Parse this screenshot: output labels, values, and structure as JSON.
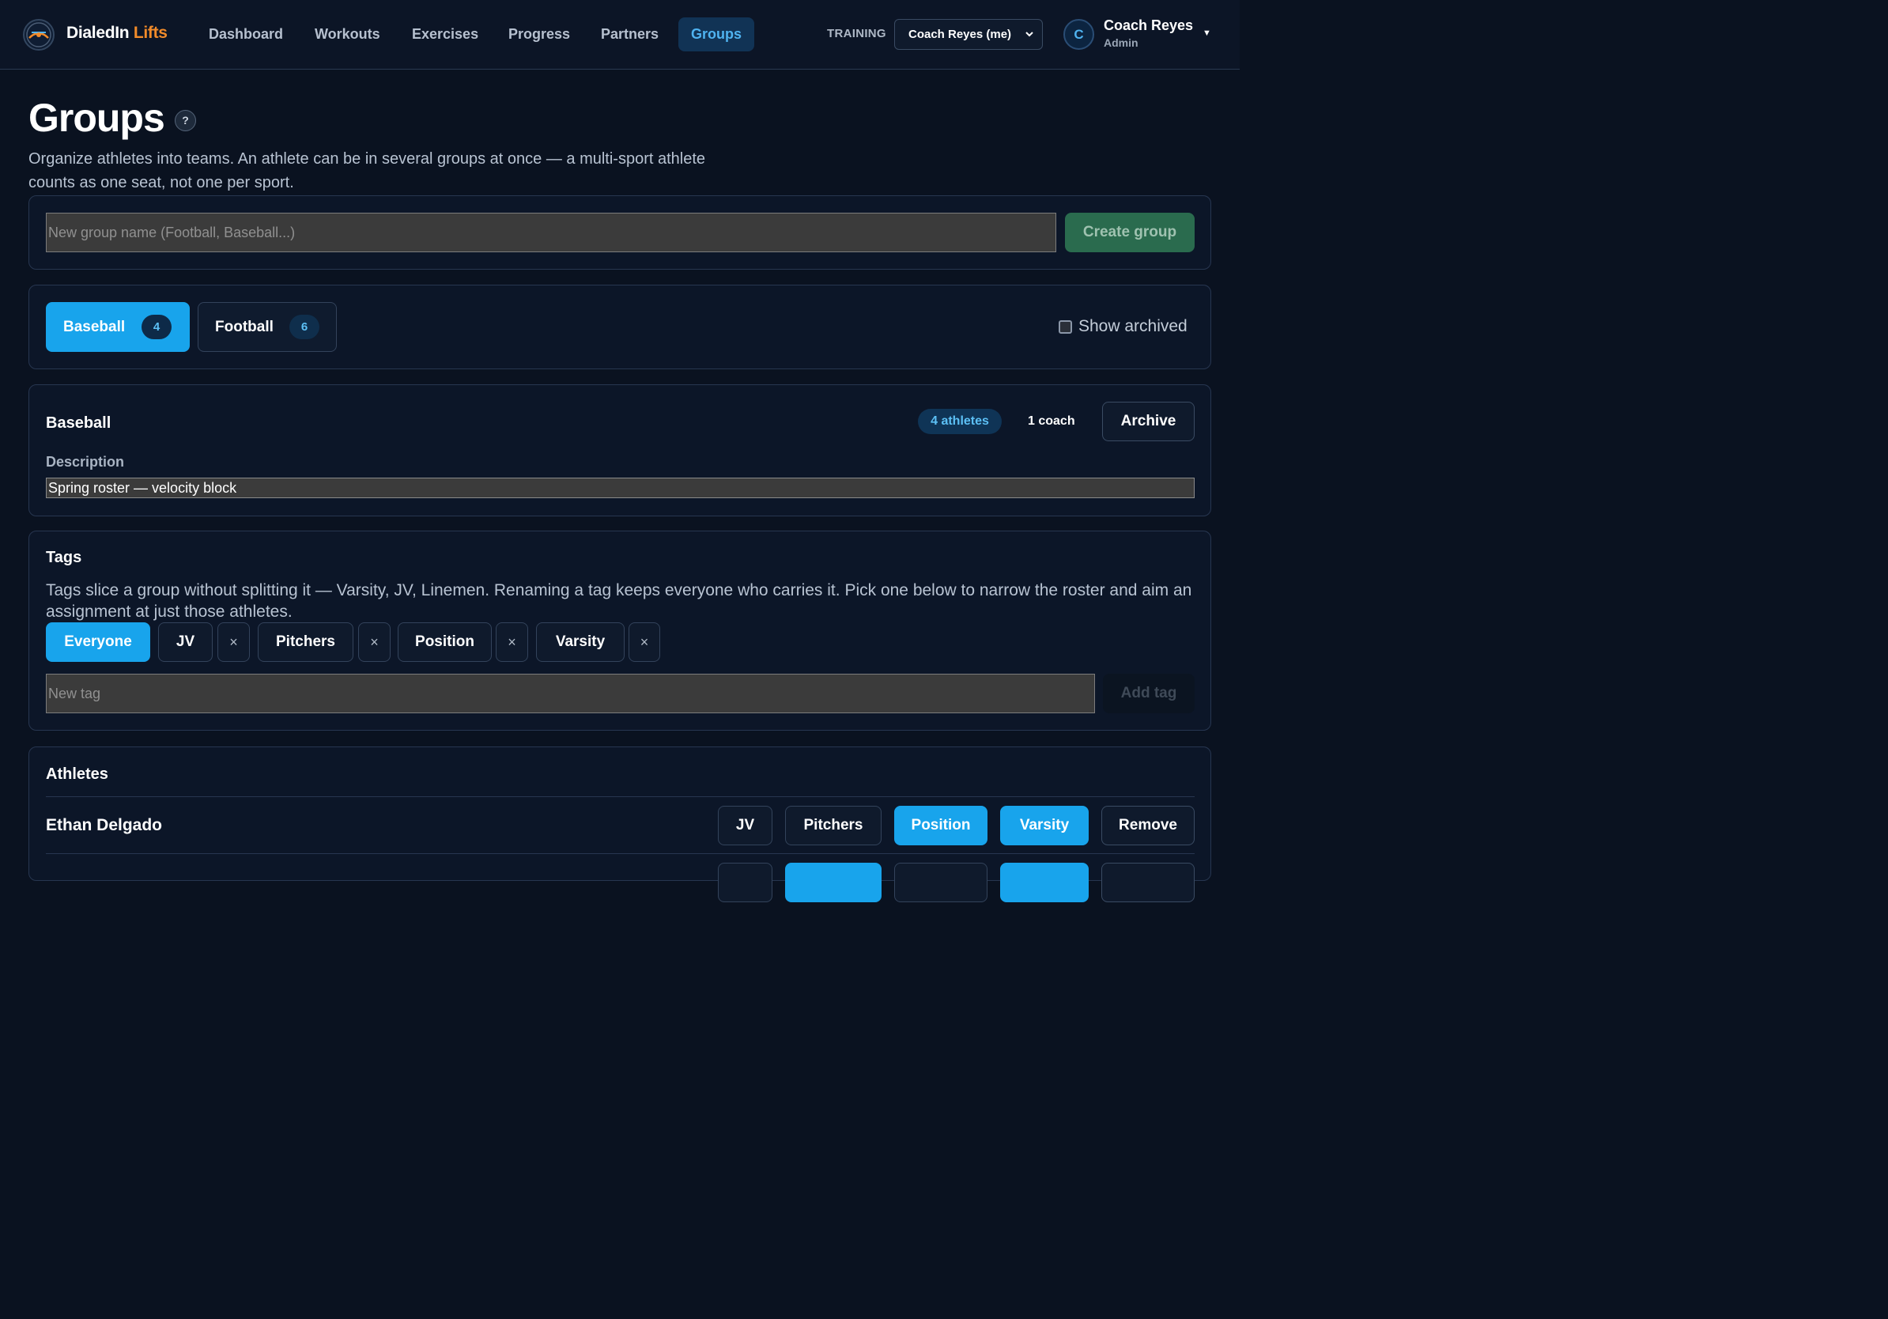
{
  "app": {
    "brand_main": "DialedIn",
    "brand_accent": "Lifts",
    "nav": [
      "Dashboard",
      "Workouts",
      "Exercises",
      "Progress",
      "Partners",
      "Groups"
    ],
    "active_nav": "Groups",
    "training_label": "TRAINING",
    "training_select": "Coach Reyes (me)",
    "user": {
      "initial": "C",
      "name": "Coach Reyes",
      "role": "Admin"
    }
  },
  "page": {
    "title": "Groups",
    "help": "?",
    "description": "Organize athletes into teams. An athlete can be in several groups at once — a multi-sport athlete counts as one seat, not one per sport."
  },
  "create": {
    "placeholder": "New group name (Football, Baseball...)",
    "button": "Create group"
  },
  "groups": {
    "tabs": [
      {
        "name": "Baseball",
        "count": "4",
        "active": true
      },
      {
        "name": "Football",
        "count": "6",
        "active": false
      }
    ],
    "show_archived": "Show archived"
  },
  "selected_group": {
    "name": "Baseball",
    "athletes_badge": "4 athletes",
    "coach_count": "1 coach",
    "archive_button": "Archive",
    "description_label": "Description",
    "description_value": "Spring roster — velocity block"
  },
  "tags": {
    "title": "Tags",
    "help": "Tags slice a group without splitting it — Varsity, JV, Linemen. Renaming a tag keeps everyone who carries it. Pick one below to narrow the roster and aim an assignment at just those athletes.",
    "everyone": "Everyone",
    "items": [
      "JV",
      "Pitchers",
      "Position",
      "Varsity"
    ],
    "remove_glyph": "×",
    "new_placeholder": "New tag",
    "add_button": "Add tag"
  },
  "athletes": {
    "title": "Athletes",
    "rows": [
      {
        "name": "Ethan Delgado",
        "tags": [
          "JV",
          "Pitchers",
          "Position",
          "Varsity"
        ],
        "tags_on": [
          false,
          false,
          true,
          true
        ],
        "remove": "Remove"
      }
    ]
  },
  "colors": {
    "accent": "#18a4ec",
    "brand_orange": "#f28b2a",
    "create_green": "#2a6b4e",
    "background": "#0a1220"
  }
}
